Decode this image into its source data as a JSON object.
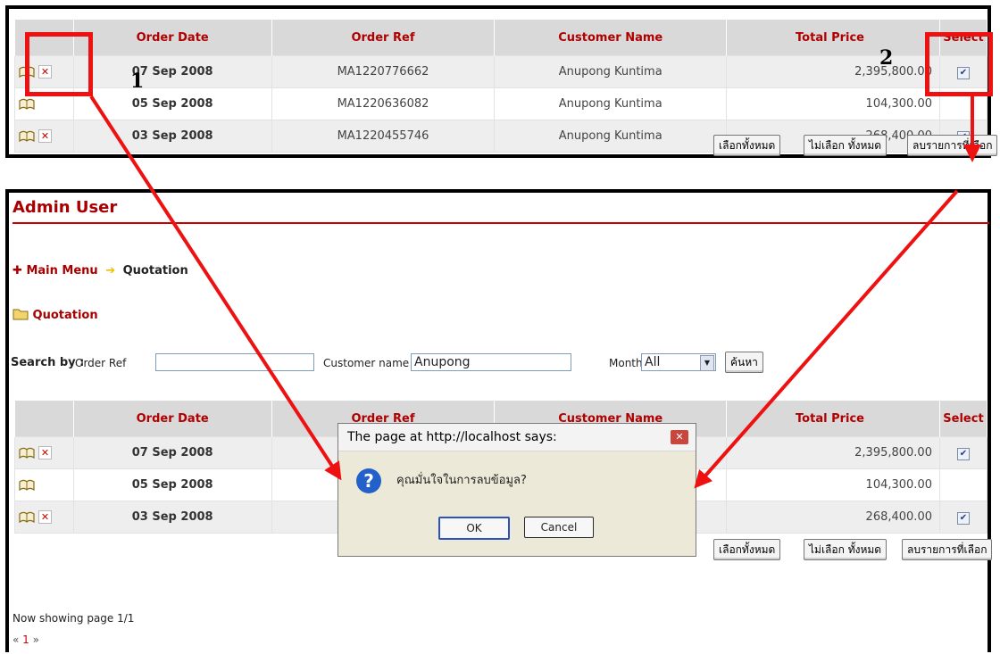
{
  "columns": [
    "Order Date",
    "Order Ref",
    "Customer Name",
    "Total Price",
    "Select"
  ],
  "rows": [
    {
      "date": "07 Sep 2008",
      "ref": "MA1220776662",
      "customer": "Anupong  Kuntima",
      "price": "2,395,800.00",
      "deletable": true,
      "checked": true
    },
    {
      "date": "05 Sep 2008",
      "ref": "MA1220636082",
      "customer": "Anupong  Kuntima",
      "price": "104,300.00",
      "deletable": false,
      "checked": false
    },
    {
      "date": "03 Sep 2008",
      "ref": "MA1220455746",
      "customer": "Anupong  Kuntima",
      "price": "268,400.00",
      "deletable": true,
      "checked": true
    }
  ],
  "actions": {
    "select_all": "เลือกทั้งหมด",
    "deselect_all": "ไม่เลือก ทั้งหมด",
    "delete_selected": "ลบรายการที่เลือก"
  },
  "admin": {
    "title": "Admin User",
    "breadcrumb": {
      "home": "Main Menu",
      "current": "Quotation"
    },
    "section": "Quotation",
    "search": {
      "label": "Search by :",
      "order_ref_label": "Order Ref",
      "order_ref_value": "",
      "customer_label": "Customer name",
      "customer_value": "Anupong",
      "month_label": "Month",
      "month_value": "All",
      "search_button": "ค้นหา"
    },
    "pager": {
      "text": "Now showing page 1/1",
      "prev": "«",
      "page": "1",
      "next": "»"
    }
  },
  "dialog": {
    "title": "The page at http://localhost says:",
    "message": "คุณมั่นใจในการลบข้อมูล?",
    "ok": "OK",
    "cancel": "Cancel"
  },
  "annotations": {
    "label1": "1",
    "label2": "2"
  },
  "colors": {
    "accent": "#a80000",
    "highlight": "#e11111",
    "header_bg": "#d9d9d9"
  }
}
